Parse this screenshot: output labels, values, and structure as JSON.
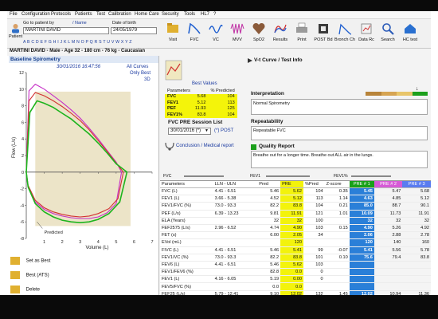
{
  "menu": [
    "File",
    "Configuration",
    "Protocols",
    "Patients",
    "Test",
    "Calibration",
    "Home Care",
    "Security",
    "Tools",
    "HL7",
    "?"
  ],
  "patient": {
    "go_label": "Go to patient by",
    "name_label": "/ Name",
    "dob_label": "Date of birth",
    "name_value": "MARTINI DAVID",
    "dob_value": "24/05/1979",
    "patient_btn": "Patient",
    "alphabet": "A B C D E F G H I J K L M N O P Q R S T U V W X Y Z"
  },
  "toolbar": [
    "Visit",
    "FVC",
    "VC",
    "MVV",
    "SpO2",
    "Results",
    "Print",
    "POST Bd",
    "Bronch Ch",
    "Data Rc",
    "Search",
    "HC test"
  ],
  "info_line": "MARTINI DAVID - Male - Age 32 - 180 cm - 76 kg - Caucasian",
  "chart": {
    "title": "Baseline Spirometry",
    "datetime": "30/01/2016   16:47:56",
    "legend": [
      "All Curves",
      "Only Best",
      "3D"
    ],
    "ylabel": "Flow  (L/s)",
    "xlabel": "Volume  (L)",
    "predicted_label": "Predicted"
  },
  "chart_data": {
    "type": "line",
    "xlabel": "Volume  (L)",
    "ylabel": "Flow  (L/s)",
    "xlim": [
      0,
      7
    ],
    "ylim": [
      -8,
      12
    ],
    "xticks": [
      1,
      2,
      3,
      4,
      5,
      6,
      7
    ],
    "yticks": [
      12,
      10,
      8,
      6,
      4,
      2,
      0,
      -2,
      -4,
      -6,
      -8
    ],
    "series": [
      {
        "name": "",
        "color": "#c62fc6",
        "x": [
          0,
          0.15,
          0.5,
          1,
          1.5,
          2,
          2.5,
          3,
          3.5,
          4,
          4.5,
          5,
          5.3,
          5,
          4.5,
          4,
          3.5,
          3,
          2.5,
          2,
          1.5,
          1,
          0.5,
          0.1,
          0
        ],
        "y": [
          0,
          9.8,
          10.6,
          10.0,
          9.2,
          8.4,
          7.5,
          6.5,
          5.3,
          4.0,
          2.6,
          1.2,
          0,
          -3.8,
          -4.9,
          -5.4,
          -5.6,
          -5.6,
          -5.5,
          -5.3,
          -5.0,
          -4.5,
          -3.6,
          -1.8,
          0
        ]
      },
      {
        "name": "",
        "color": "#d23030",
        "x": [
          0,
          0.15,
          0.5,
          1,
          1.5,
          2,
          2.5,
          3,
          3.5,
          4,
          4.5,
          5,
          5.4,
          5.1,
          4.6,
          4,
          3.5,
          3,
          2.5,
          2,
          1.5,
          1,
          0.5,
          0.1,
          0
        ],
        "y": [
          0,
          8.6,
          9.6,
          9.2,
          8.6,
          7.9,
          7.1,
          6.2,
          5.1,
          3.8,
          2.5,
          1.1,
          0,
          -3.2,
          -4.4,
          -5.0,
          -5.3,
          -5.4,
          -5.3,
          -5.1,
          -4.8,
          -4.3,
          -3.4,
          -1.6,
          0
        ]
      },
      {
        "name": "",
        "color": "#1db41d",
        "x": [
          0,
          0.2,
          0.6,
          1,
          1.5,
          2,
          2.5,
          3,
          3.5,
          4,
          4.5,
          5,
          5.6,
          5.2,
          4.6,
          4,
          3.5,
          3,
          2.5,
          2,
          1.5,
          1,
          0.5,
          0.1,
          0
        ],
        "y": [
          0,
          7.2,
          8.6,
          8.3,
          7.8,
          7.1,
          6.4,
          5.5,
          4.6,
          3.5,
          2.3,
          1.0,
          0,
          -3.6,
          -5.0,
          -5.7,
          -6.0,
          -6.1,
          -6.0,
          -5.8,
          -5.4,
          -4.8,
          -3.8,
          -1.8,
          0
        ]
      }
    ],
    "predicted_box": {
      "x": [
        0.5,
        5.8
      ],
      "y": [
        -6.5,
        9.7
      ]
    }
  },
  "side_buttons": [
    "Set as Best",
    "Best (ATS)",
    "Delete"
  ],
  "best_values": {
    "title": "Best Values",
    "headers": [
      "Parameters",
      "% Predicted"
    ],
    "rows": [
      [
        "FVC",
        "5.68",
        "104"
      ],
      [
        "FEV1",
        "5.12",
        "113"
      ],
      [
        "PEF",
        "11.93",
        "125"
      ],
      [
        "FEV1%",
        "83.8",
        "104"
      ]
    ]
  },
  "session": {
    "title": "FVC PRE Session List",
    "date_value": "30/01/2016 (*)",
    "post_label": "(*) POST",
    "conclusion_btn": "Conclusion / Medical report"
  },
  "right_header": "V-t Curve / Test Info",
  "interpretation": {
    "title": "Interpretation",
    "text": "Normal Spirometry"
  },
  "repeatability": {
    "title": "Repeatability",
    "text": "Repeatable FVC"
  },
  "quality": {
    "title": "Quality Report",
    "text": "Breathe out for a longer time. Breathe out ALL air in the lungs."
  },
  "scales": [
    "FVC",
    "FEV1",
    "FEV1%"
  ],
  "params": {
    "headers": [
      "Parameters",
      "LLN - ULN",
      "Pred",
      "PRE",
      "%Pred",
      "Z-score",
      "PRE # 1",
      "PRE # 2",
      "PRE # 3"
    ],
    "rows": [
      [
        "FVC (L)",
        "4.41 - 6.51",
        "5.46",
        "5.62",
        "104",
        "0.35",
        "5.45",
        "5.47",
        "5.68"
      ],
      [
        "FEV1 (L)",
        "3.66 - 5.38",
        "4.52",
        "5.12",
        "113",
        "1.14",
        "4.63",
        "4.85",
        "5.12"
      ],
      [
        "FEV1/FVC (%)",
        "73.0 - 93.3",
        "82.2",
        "83.8",
        "104",
        "0.21",
        "85.0",
        "88.7",
        "90.1"
      ],
      [
        "PEF (L/s)",
        "6.39 - 13.23",
        "9.81",
        "11.91",
        "121",
        "1.01",
        "10.09",
        "11.73",
        "11.91"
      ],
      [
        "ELA (Years)",
        "",
        "32",
        "32",
        "100",
        "",
        "32",
        "32",
        "32"
      ],
      [
        "FEF2575 (L/s)",
        "2.96 - 6.52",
        "4.74",
        "4.90",
        "103",
        "0.15",
        "4.90",
        "5.26",
        "4.92"
      ],
      [
        "FET (s)",
        "",
        "6.00",
        "2.05",
        "34",
        "",
        "2.06",
        "2.88",
        "2.78"
      ],
      [
        "EVol (mL)",
        "",
        "",
        "120",
        "",
        "",
        "120",
        "140",
        "160"
      ],
      [
        "FIVC (L)",
        "4.41 - 6.51",
        "5.46",
        "5.41",
        "99",
        "-0.07",
        "5.41",
        "5.56",
        "5.78"
      ],
      [
        "FEV1/VC (%)",
        "73.0 - 93.3",
        "82.2",
        "83.8",
        "101",
        "0.10",
        "75.6",
        "79.4",
        "83.8"
      ],
      [
        "FEV6 (L)",
        "4.41 - 6.51",
        "5.46",
        "5.62",
        "103",
        "",
        "",
        "",
        ""
      ],
      [
        "FEV1/FEV6 (%)",
        "",
        "82.8",
        "0.0",
        "0",
        "",
        "",
        "",
        ""
      ],
      [
        "FEV1 (L)",
        "4.16 - 6.05",
        "5.19",
        "0.00",
        "0",
        "",
        "",
        "",
        ""
      ],
      [
        "FEV5/FVC (%)",
        "",
        "0.0",
        "0.0",
        "",
        "",
        "",
        "",
        ""
      ],
      [
        "FEF25 (L/s)",
        "5.79 - 12.41",
        "9.10",
        "12.02",
        "132",
        "1.45",
        "12.02",
        "10.94",
        "11.36"
      ]
    ]
  },
  "colors": {
    "pre1": "#2a7fd8",
    "pre": "#f3f30c",
    "predicted": "#ece4c8"
  }
}
